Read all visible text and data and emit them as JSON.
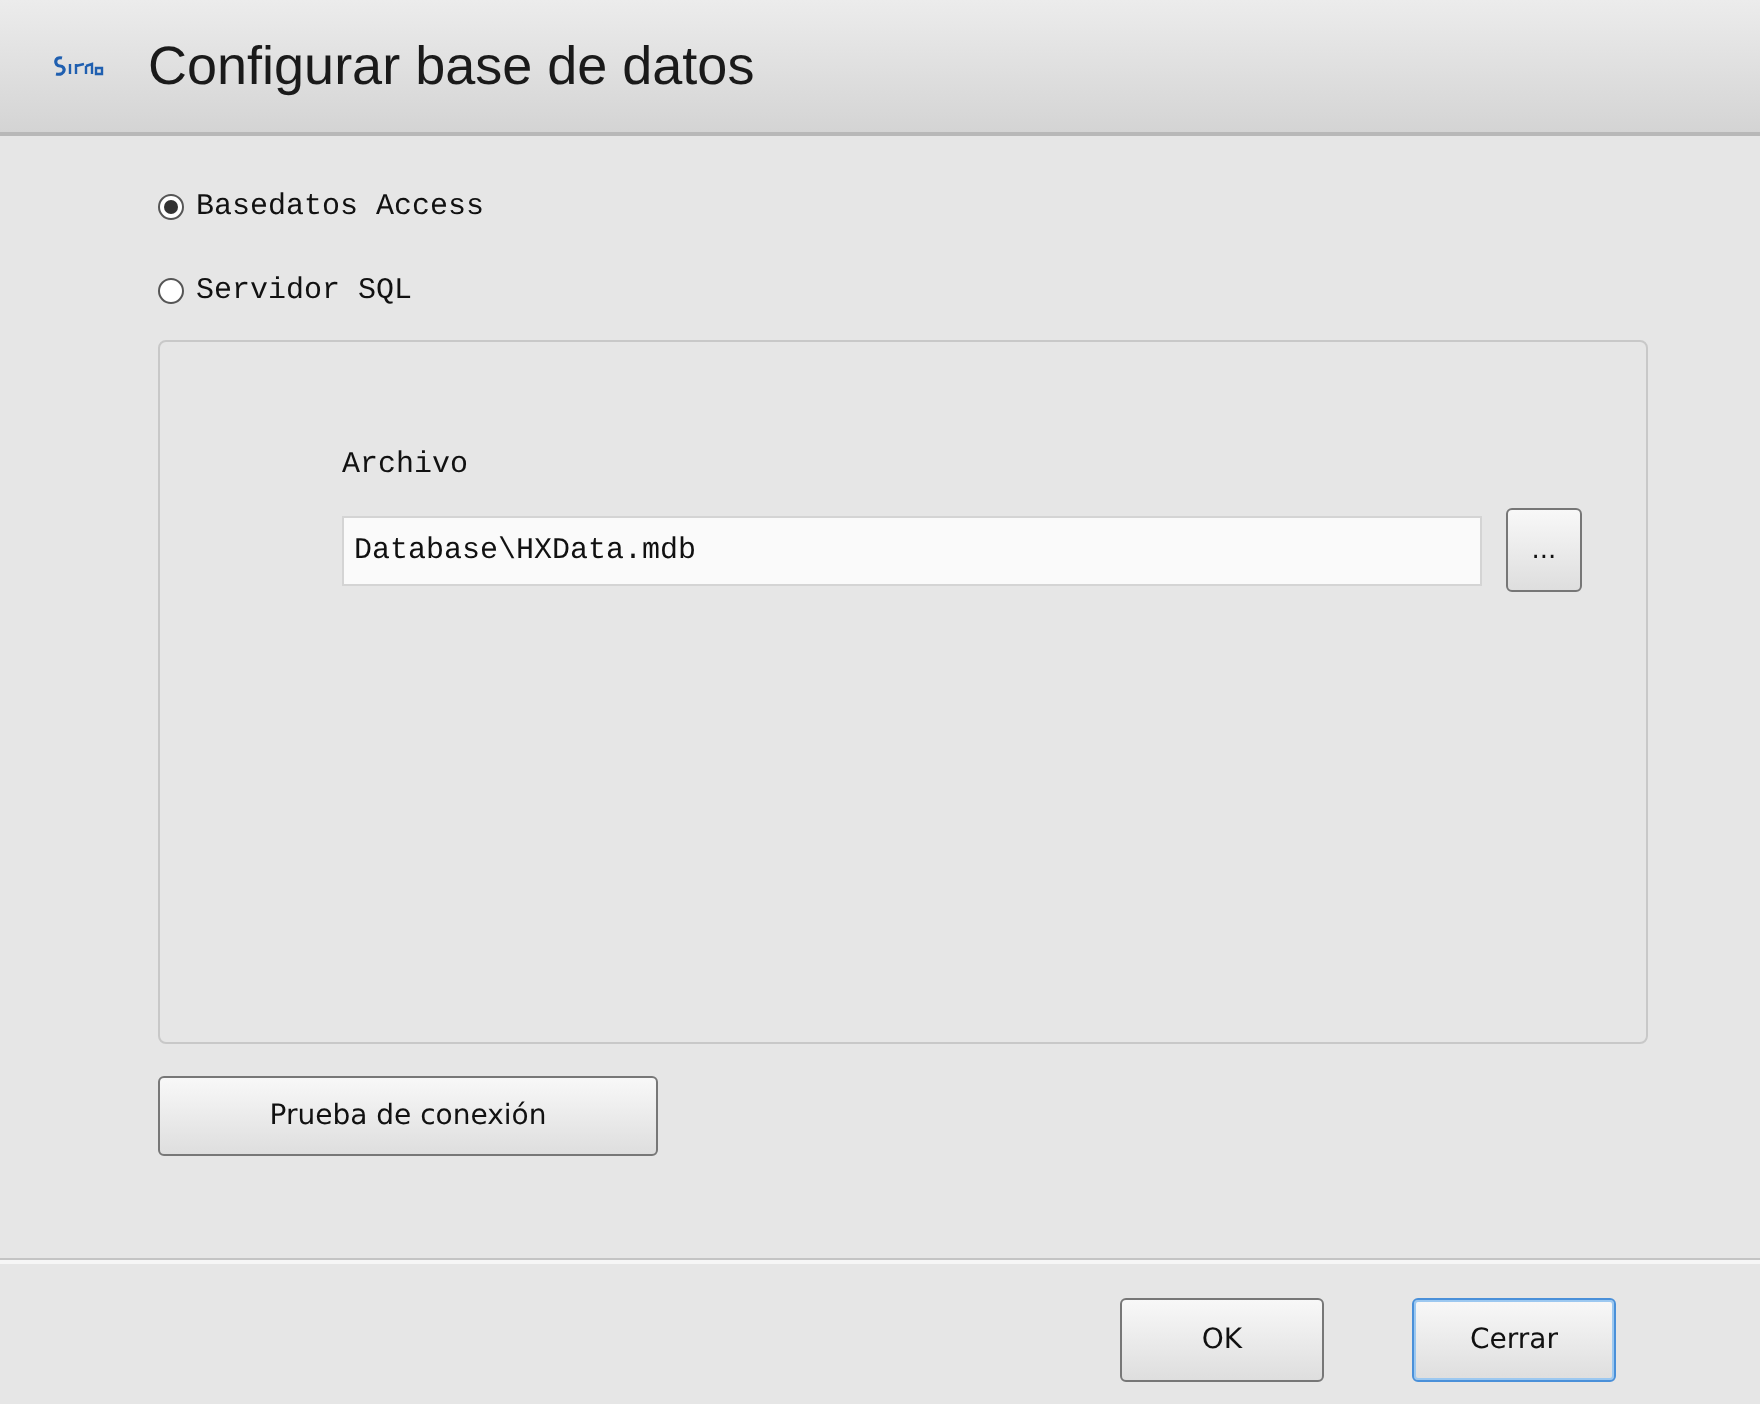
{
  "window": {
    "title": "Configurar base de datos"
  },
  "database_types": [
    {
      "label": "Basedatos Access",
      "selected": true
    },
    {
      "label": "Servidor SQL",
      "selected": false
    }
  ],
  "file_field": {
    "label": "Archivo",
    "value": "Database\\HXData.mdb",
    "browse_button": "..."
  },
  "test_button": "Prueba de conexión",
  "buttons": [
    {
      "label": "OK",
      "kind": "normal"
    },
    {
      "label": "Cerrar",
      "kind": "default"
    }
  ]
}
